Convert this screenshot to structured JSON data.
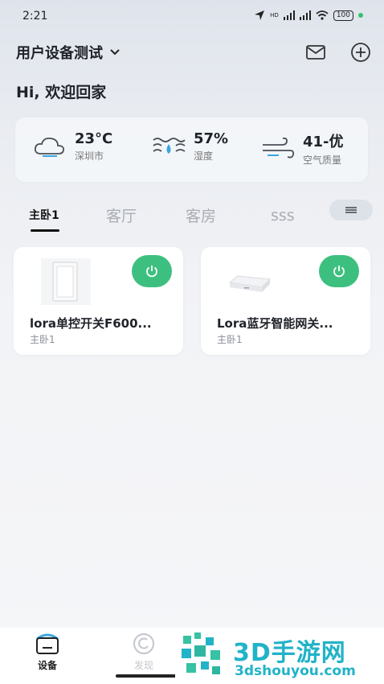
{
  "status_bar": {
    "time": "2:21",
    "signal_label": "HD",
    "battery": "100"
  },
  "header": {
    "home_name": "用户设备测试",
    "greeting": "Hi, 欢迎回家"
  },
  "weather": [
    {
      "icon": "cloud-icon",
      "value": "23°C",
      "label": "深圳市"
    },
    {
      "icon": "humidity-icon",
      "value": "57%",
      "label": "湿度"
    },
    {
      "icon": "wind-icon",
      "value": "41-优",
      "label": "空气质量"
    }
  ],
  "tabs": [
    {
      "label": "主卧1",
      "active": true
    },
    {
      "label": "客厅",
      "active": false
    },
    {
      "label": "客房",
      "active": false
    },
    {
      "label": "sss",
      "active": false
    }
  ],
  "devices": [
    {
      "name": "lora单控开关F600...",
      "room": "主卧1",
      "power_on": true
    },
    {
      "name": "Lora蓝牙智能网关...",
      "room": "主卧1",
      "power_on": true
    }
  ],
  "bottom_nav": [
    {
      "label": "设备",
      "icon": "home-icon",
      "active": true
    },
    {
      "label": "发现",
      "icon": "discover-icon",
      "active": false
    }
  ],
  "watermark": {
    "big": "3D手游网",
    "small": "3dshouyou.com"
  },
  "colors": {
    "accent_green": "#3dc07f",
    "watermark": "#21b3c8"
  }
}
